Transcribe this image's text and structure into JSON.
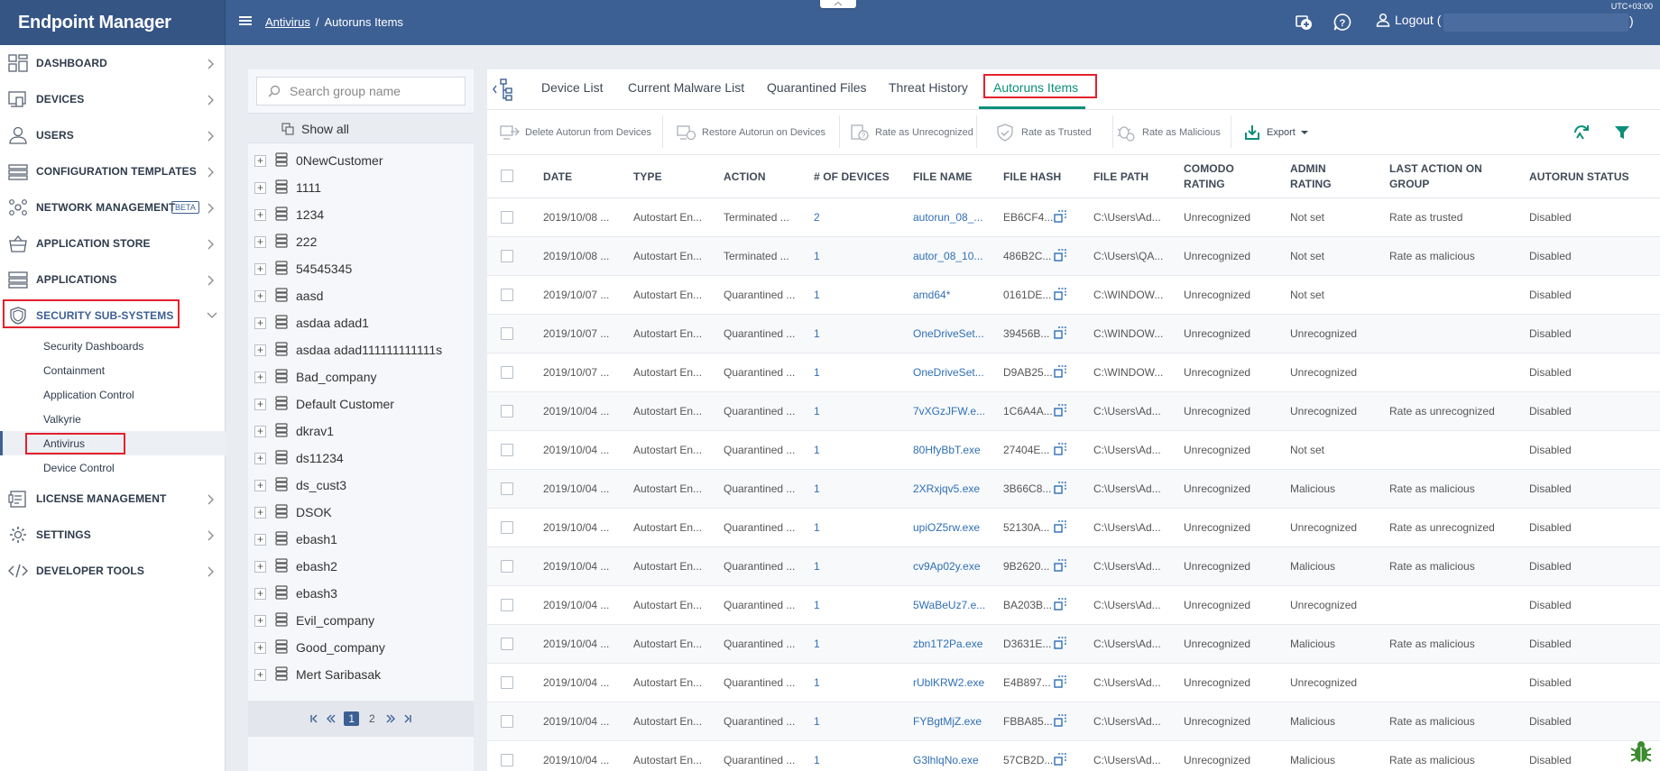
{
  "app": {
    "title": "Endpoint Manager",
    "timezone": "UTC+03:00"
  },
  "header": {
    "breadcrumb_parent": "Antivirus",
    "breadcrumb_current": "Autoruns Items",
    "logout_label": "Logout (",
    "logout_suffix": ")"
  },
  "sidebar": {
    "items": [
      {
        "label": "DASHBOARD",
        "icon": "dashboard-icon"
      },
      {
        "label": "DEVICES",
        "icon": "devices-icon"
      },
      {
        "label": "USERS",
        "icon": "users-icon"
      },
      {
        "label": "CONFIGURATION TEMPLATES",
        "icon": "templates-icon"
      },
      {
        "label": "NETWORK MANAGEMENT",
        "icon": "network-icon",
        "badge": "BETA"
      },
      {
        "label": "APPLICATION STORE",
        "icon": "store-icon"
      },
      {
        "label": "APPLICATIONS",
        "icon": "applications-icon"
      },
      {
        "label": "SECURITY SUB-SYSTEMS",
        "icon": "shield-icon"
      },
      {
        "label": "LICENSE MANAGEMENT",
        "icon": "license-icon"
      },
      {
        "label": "SETTINGS",
        "icon": "gear-icon"
      },
      {
        "label": "DEVELOPER TOOLS",
        "icon": "code-icon"
      }
    ],
    "security_subitems": [
      "Security Dashboards",
      "Containment",
      "Application Control",
      "Valkyrie",
      "Antivirus",
      "Device Control"
    ],
    "active_subitem": "Antivirus"
  },
  "groups": {
    "search_placeholder": "Search group name",
    "show_all": "Show all",
    "items": [
      "0NewCustomer",
      "1111",
      "1234",
      "222",
      "54545345",
      "aasd",
      "asdaa adad1",
      "asdaa adad111111111111s",
      "Bad_company",
      "Default Customer",
      "dkrav1",
      "ds11234",
      "ds_cust3",
      "DSOK",
      "ebash1",
      "ebash2",
      "ebash3",
      "Evil_company",
      "Good_company",
      "Mert Saribasak"
    ],
    "pages": [
      "1",
      "2"
    ],
    "current_page": "1"
  },
  "tabs": [
    {
      "label": "Device List"
    },
    {
      "label": "Current Malware List"
    },
    {
      "label": "Quarantined Files"
    },
    {
      "label": "Threat History"
    },
    {
      "label": "Autoruns Items"
    }
  ],
  "active_tab": "Autoruns Items",
  "toolbar": {
    "delete": "Delete Autorun from Devices",
    "restore": "Restore Autorun on Devices",
    "rate_unrecognized": "Rate as Unrecognized",
    "rate_trusted": "Rate as Trusted",
    "rate_malicious": "Rate as Malicious",
    "export": "Export"
  },
  "table": {
    "headers": {
      "date": "DATE",
      "type": "TYPE",
      "action": "ACTION",
      "devices": "# OF DEVICES",
      "file_name": "FILE NAME",
      "file_hash": "FILE HASH",
      "file_path": "FILE PATH",
      "comodo_rating_1": "COMODO",
      "comodo_rating_2": "RATING",
      "admin_rating_1": "ADMIN",
      "admin_rating_2": "RATING",
      "last_action_1": "LAST ACTION ON",
      "last_action_2": "GROUP",
      "status": "AUTORUN STATUS"
    },
    "rows": [
      {
        "date": "2019/10/08 ...",
        "type": "Autostart En...",
        "action": "Terminated ...",
        "devices": "2",
        "file_name": "autorun_08_...",
        "file_hash": "EB6CF4...",
        "file_path": "C:\\Users\\Ad...",
        "comodo": "Unrecognized",
        "admin": "Not set",
        "last_action": "Rate as trusted",
        "status": "Disabled"
      },
      {
        "date": "2019/10/08 ...",
        "type": "Autostart En...",
        "action": "Terminated ...",
        "devices": "1",
        "file_name": "autor_08_10...",
        "file_hash": "486B2C...",
        "file_path": "C:\\Users\\QA...",
        "comodo": "Unrecognized",
        "admin": "Not set",
        "last_action": "Rate as malicious",
        "status": "Disabled"
      },
      {
        "date": "2019/10/07 ...",
        "type": "Autostart En...",
        "action": "Quarantined ...",
        "devices": "1",
        "file_name": "amd64*",
        "file_hash": "0161DE...",
        "file_path": "C:\\WINDOW...",
        "comodo": "Unrecognized",
        "admin": "Not set",
        "last_action": "",
        "status": "Disabled"
      },
      {
        "date": "2019/10/07 ...",
        "type": "Autostart En...",
        "action": "Quarantined ...",
        "devices": "1",
        "file_name": "OneDriveSet...",
        "file_hash": "39456B...",
        "file_path": "C:\\WINDOW...",
        "comodo": "Unrecognized",
        "admin": "Unrecognized",
        "last_action": "",
        "status": "Disabled"
      },
      {
        "date": "2019/10/07 ...",
        "type": "Autostart En...",
        "action": "Quarantined ...",
        "devices": "1",
        "file_name": "OneDriveSet...",
        "file_hash": "D9AB25...",
        "file_path": "C:\\WINDOW...",
        "comodo": "Unrecognized",
        "admin": "Unrecognized",
        "last_action": "",
        "status": "Disabled"
      },
      {
        "date": "2019/10/04 ...",
        "type": "Autostart En...",
        "action": "Quarantined ...",
        "devices": "1",
        "file_name": "7vXGzJFW.e...",
        "file_hash": "1C6A4A...",
        "file_path": "C:\\Users\\Ad...",
        "comodo": "Unrecognized",
        "admin": "Unrecognized",
        "last_action": "Rate as unrecognized",
        "status": "Disabled"
      },
      {
        "date": "2019/10/04 ...",
        "type": "Autostart En...",
        "action": "Quarantined ...",
        "devices": "1",
        "file_name": "80HfyBbT.exe",
        "file_hash": "27404E...",
        "file_path": "C:\\Users\\Ad...",
        "comodo": "Unrecognized",
        "admin": "Not set",
        "last_action": "",
        "status": "Disabled"
      },
      {
        "date": "2019/10/04 ...",
        "type": "Autostart En...",
        "action": "Quarantined ...",
        "devices": "1",
        "file_name": "2XRxjqv5.exe",
        "file_hash": "3B66C8...",
        "file_path": "C:\\Users\\Ad...",
        "comodo": "Unrecognized",
        "admin": "Malicious",
        "last_action": "Rate as malicious",
        "status": "Disabled"
      },
      {
        "date": "2019/10/04 ...",
        "type": "Autostart En...",
        "action": "Quarantined ...",
        "devices": "1",
        "file_name": "upiOZ5rw.exe",
        "file_hash": "52130A...",
        "file_path": "C:\\Users\\Ad...",
        "comodo": "Unrecognized",
        "admin": "Unrecognized",
        "last_action": "Rate as unrecognized",
        "status": "Disabled"
      },
      {
        "date": "2019/10/04 ...",
        "type": "Autostart En...",
        "action": "Quarantined ...",
        "devices": "1",
        "file_name": "cv9Ap02y.exe",
        "file_hash": "9B2620...",
        "file_path": "C:\\Users\\Ad...",
        "comodo": "Unrecognized",
        "admin": "Malicious",
        "last_action": "Rate as malicious",
        "status": "Disabled"
      },
      {
        "date": "2019/10/04 ...",
        "type": "Autostart En...",
        "action": "Quarantined ...",
        "devices": "1",
        "file_name": "5WaBeUz7.e...",
        "file_hash": "BA203B...",
        "file_path": "C:\\Users\\Ad...",
        "comodo": "Unrecognized",
        "admin": "Unrecognized",
        "last_action": "",
        "status": "Disabled"
      },
      {
        "date": "2019/10/04 ...",
        "type": "Autostart En...",
        "action": "Quarantined ...",
        "devices": "1",
        "file_name": "zbn1T2Pa.exe",
        "file_hash": "D3631E...",
        "file_path": "C:\\Users\\Ad...",
        "comodo": "Unrecognized",
        "admin": "Malicious",
        "last_action": "Rate as malicious",
        "status": "Disabled"
      },
      {
        "date": "2019/10/04 ...",
        "type": "Autostart En...",
        "action": "Quarantined ...",
        "devices": "1",
        "file_name": "rUblKRW2.exe",
        "file_hash": "E4B897...",
        "file_path": "C:\\Users\\Ad...",
        "comodo": "Unrecognized",
        "admin": "Unrecognized",
        "last_action": "",
        "status": "Disabled"
      },
      {
        "date": "2019/10/04 ...",
        "type": "Autostart En...",
        "action": "Quarantined ...",
        "devices": "1",
        "file_name": "FYBgtMjZ.exe",
        "file_hash": "FBBA85...",
        "file_path": "C:\\Users\\Ad...",
        "comodo": "Unrecognized",
        "admin": "Malicious",
        "last_action": "Rate as malicious",
        "status": "Disabled"
      },
      {
        "date": "2019/10/04 ...",
        "type": "Autostart En...",
        "action": "Quarantined ...",
        "devices": "1",
        "file_name": "G3lhlqNo.exe",
        "file_hash": "57CB2D...",
        "file_path": "C:\\Users\\Ad...",
        "comodo": "Unrecognized",
        "admin": "Malicious",
        "last_action": "Rate as malicious",
        "status": "Disabled"
      }
    ]
  },
  "colors": {
    "header_bg": "#3d6094",
    "accent_teal": "#0c8f7a",
    "link_blue": "#2f6fb5",
    "highlight_red": "#e3212d"
  }
}
